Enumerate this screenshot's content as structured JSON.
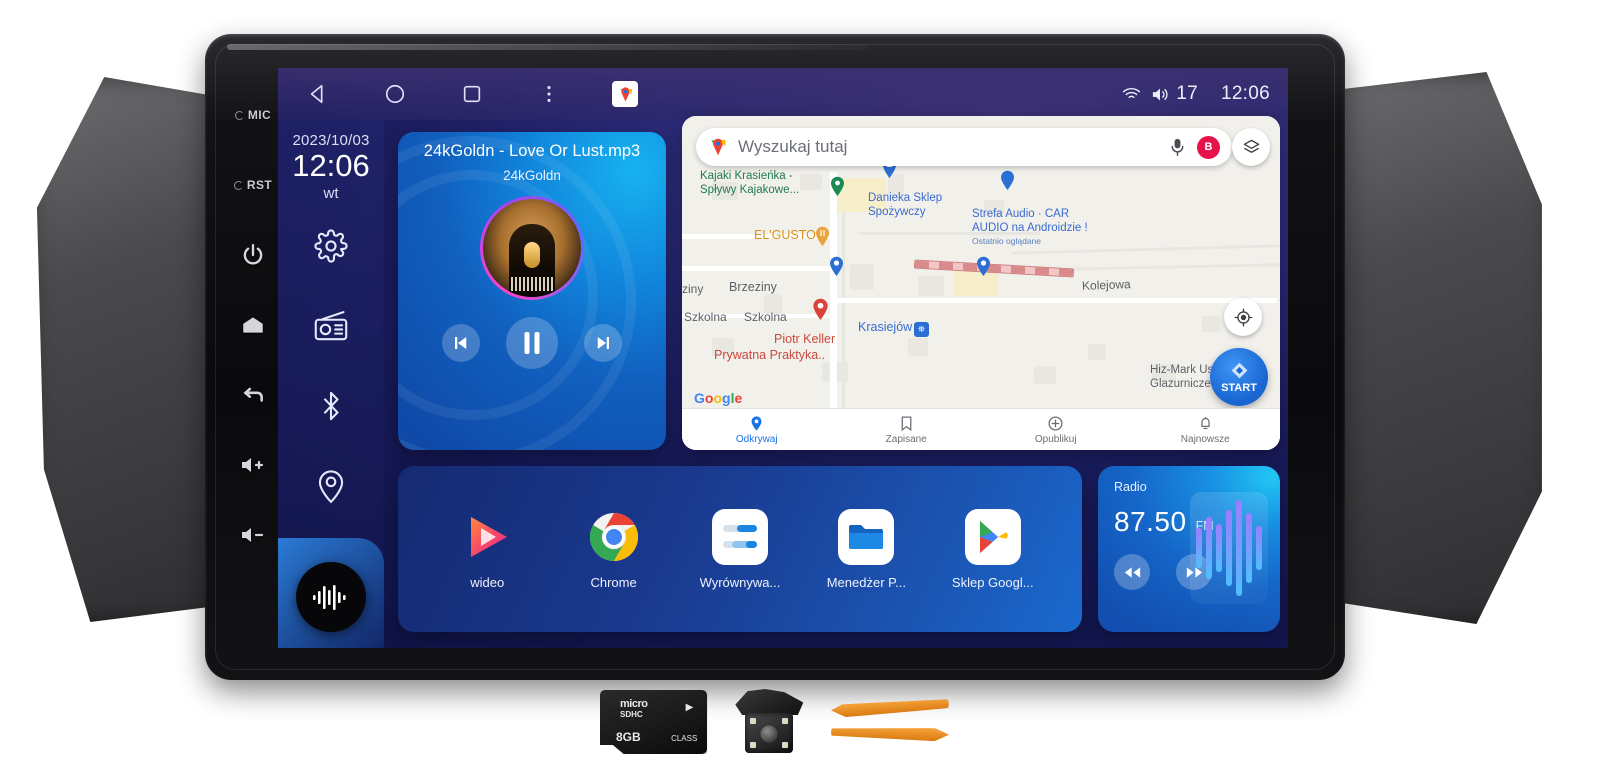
{
  "hardware_keys": [
    {
      "name": "mic-key",
      "label": "MIC",
      "type": "text"
    },
    {
      "name": "reset-key",
      "label": "RST",
      "type": "text"
    },
    {
      "name": "power-key",
      "label": "power-icon",
      "type": "icon"
    },
    {
      "name": "home-key",
      "label": "home-icon",
      "type": "icon"
    },
    {
      "name": "back-key",
      "label": "back-icon",
      "type": "icon"
    },
    {
      "name": "volume-up-key",
      "label": "volume-up-icon",
      "type": "icon"
    },
    {
      "name": "volume-down-key",
      "label": "volume-down-icon",
      "type": "icon"
    }
  ],
  "statusbar": {
    "nav": [
      {
        "name": "back-icon",
        "label": "back"
      },
      {
        "name": "home-icon",
        "label": "home"
      },
      {
        "name": "recents-icon",
        "label": "recents"
      },
      {
        "name": "overflow-menu-icon",
        "label": "more"
      },
      {
        "name": "google-maps-icon",
        "label": "Maps"
      }
    ],
    "wifi_icon": "wifi-icon",
    "volume_icon": "volume-icon",
    "volume_level": "17",
    "clock": "12:06"
  },
  "rail": {
    "date": "2023/10/03",
    "time": "12:06",
    "day_of_week": "wt",
    "icons": [
      {
        "name": "settings-icon",
        "label": "Ustawienia"
      },
      {
        "name": "radio-icon",
        "label": "Radio"
      },
      {
        "name": "bluetooth-icon",
        "label": "Bluetooth"
      },
      {
        "name": "location-icon",
        "label": "Nawigacja"
      }
    ],
    "music_orb": "music-waveform-icon"
  },
  "media": {
    "title": "24kGoldn - Love Or Lust.mp3",
    "artist": "24kGoldn",
    "album_art": "album-art",
    "controls": [
      {
        "name": "previous-track-button",
        "glyph": "previous"
      },
      {
        "name": "pause-button",
        "glyph": "pause"
      },
      {
        "name": "next-track-button",
        "glyph": "next"
      }
    ]
  },
  "map": {
    "search_placeholder": "Wyszukaj tutaj",
    "mic_icon": "microphone-icon",
    "avatar_initial": "B",
    "layers_icon": "layers-icon",
    "locate_icon": "my-location-icon",
    "start_button": "START",
    "google_watermark": [
      "G",
      "o",
      "o",
      "g",
      "l",
      "e"
    ],
    "labels": [
      {
        "text": "Kajaki Krasieńka -",
        "color": "green"
      },
      {
        "text": "Spływy Kajakowe...",
        "color": "green"
      },
      {
        "text": "Danieka Sklep",
        "color": "blue"
      },
      {
        "text": "Spożywczy",
        "color": "blue"
      },
      {
        "text": "Strefa Audio · CAR",
        "color": "blue"
      },
      {
        "text": "AUDIO na Androidzie !",
        "color": "blue"
      },
      {
        "text": "Ostatnio oglądane",
        "color": "sub"
      },
      {
        "text": "EL'GUSTO",
        "color": "orange"
      },
      {
        "text": "Brzeziny",
        "color": "dark"
      },
      {
        "text": "ziny",
        "color": "dark"
      },
      {
        "text": "Szkolna",
        "color": "dark"
      },
      {
        "text": "Szkolna",
        "color": "dark"
      },
      {
        "text": "Kolejowa",
        "color": "dark"
      },
      {
        "text": "Krasiejów",
        "color": "blue"
      },
      {
        "text": "Piotr Keller",
        "color": "red"
      },
      {
        "text": "Prywatna Praktyka..",
        "color": "red"
      },
      {
        "text": "Hiz-Mark Usługi",
        "color": "dark"
      },
      {
        "text": "Glazurnicze",
        "color": "dark"
      }
    ],
    "tabs": [
      {
        "label": "Odkrywaj",
        "icon": "explore-pin-icon",
        "active": true
      },
      {
        "label": "Zapisane",
        "icon": "bookmark-icon",
        "active": false
      },
      {
        "label": "Opublikuj",
        "icon": "contribute-icon",
        "active": false
      },
      {
        "label": "Najnowsze",
        "icon": "updates-bell-icon",
        "active": false
      }
    ]
  },
  "apps": [
    {
      "label": "wideo",
      "icon": "video-player-icon"
    },
    {
      "label": "Chrome",
      "icon": "chrome-icon"
    },
    {
      "label": "Wyrównywa...",
      "icon": "equalizer-icon"
    },
    {
      "label": "Menedżer P...",
      "icon": "file-manager-icon"
    },
    {
      "label": "Sklep Googl...",
      "icon": "google-play-icon"
    }
  ],
  "radio": {
    "label": "Radio",
    "frequency": "87.50",
    "band": "FM",
    "prev_button": "rewind-icon",
    "next_button": "fast-forward-icon",
    "eq_icon": "equalizer-bars-icon",
    "eq_bars": [
      40,
      62,
      48,
      76,
      96,
      70,
      44
    ]
  },
  "accessories": [
    {
      "name": "microsd-card",
      "brand": "micro",
      "standard": "SDHC",
      "capacity": "8GB",
      "class": "CLASS",
      "class_num": "C"
    },
    {
      "name": "rear-view-camera"
    },
    {
      "name": "pry-tools"
    }
  ],
  "colors": {
    "screen_accent": "#1a73e8",
    "media_blue": "#1186dc",
    "radio_blue": "#1565c8",
    "brand_red": "#e8124a"
  }
}
